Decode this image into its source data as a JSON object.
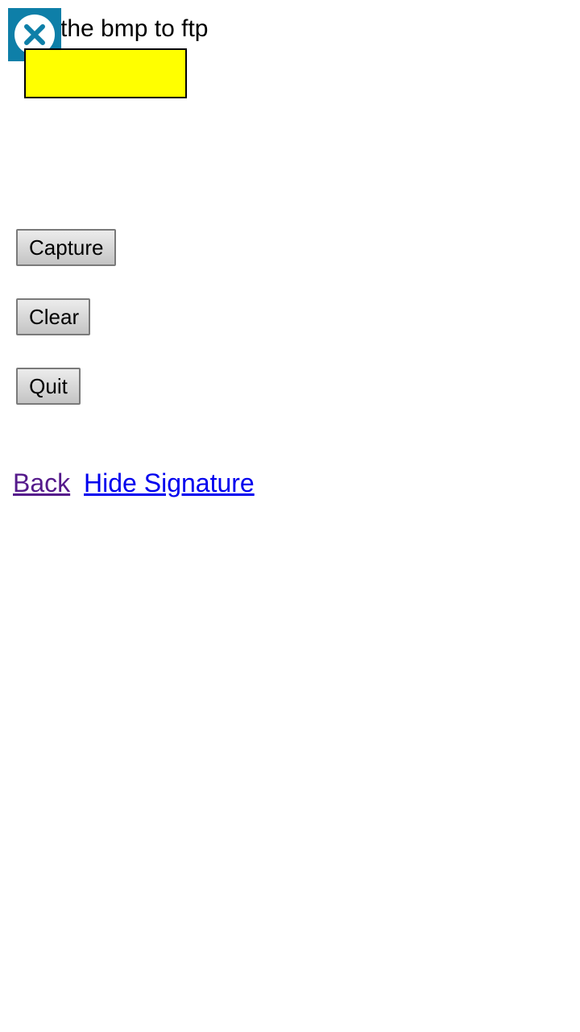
{
  "header": {
    "text": "d the bmp to ftp"
  },
  "colors": {
    "close_badge": "#0e7fa8",
    "signature_box": "#ffff00",
    "link_visited": "#551a8b",
    "link": "#0000ee"
  },
  "buttons": {
    "capture": "Capture",
    "clear": "Clear",
    "quit": "Quit"
  },
  "links": {
    "back": "Back",
    "hide_signature": "Hide Signature"
  },
  "icons": {
    "close": "close-circle-icon"
  }
}
